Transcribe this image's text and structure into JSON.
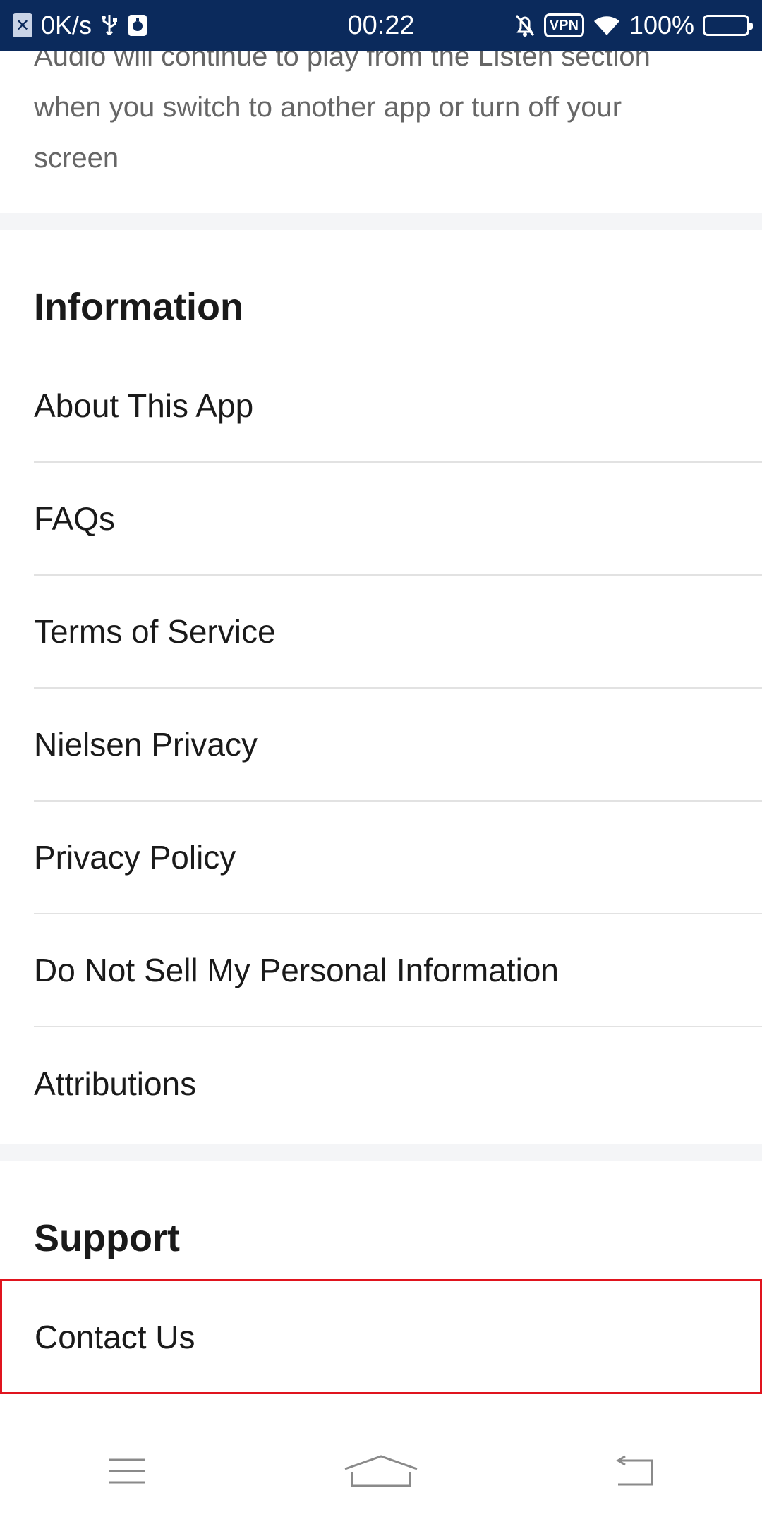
{
  "status_bar": {
    "speed": "0K/s",
    "time": "00:22",
    "vpn": "VPN",
    "battery": "100%"
  },
  "audio_note": {
    "text": "Audio will continue to play from the Listen section when you switch to another app or turn off your screen"
  },
  "information": {
    "title": "Information",
    "items": [
      {
        "label": "About This App"
      },
      {
        "label": "FAQs"
      },
      {
        "label": "Terms of Service"
      },
      {
        "label": "Nielsen Privacy"
      },
      {
        "label": "Privacy Policy"
      },
      {
        "label": "Do Not Sell My Personal Information"
      },
      {
        "label": "Attributions"
      }
    ]
  },
  "support": {
    "title": "Support",
    "items": [
      {
        "label": "Contact Us"
      }
    ]
  },
  "nav_bar": {
    "icons": [
      "menu-icon",
      "home-icon",
      "back-icon"
    ]
  },
  "colors": {
    "status_bar_bg": "#0b2a5c",
    "highlight_border": "#e0141e",
    "divider": "#e2e2e2",
    "section_band": "#f4f5f7"
  }
}
